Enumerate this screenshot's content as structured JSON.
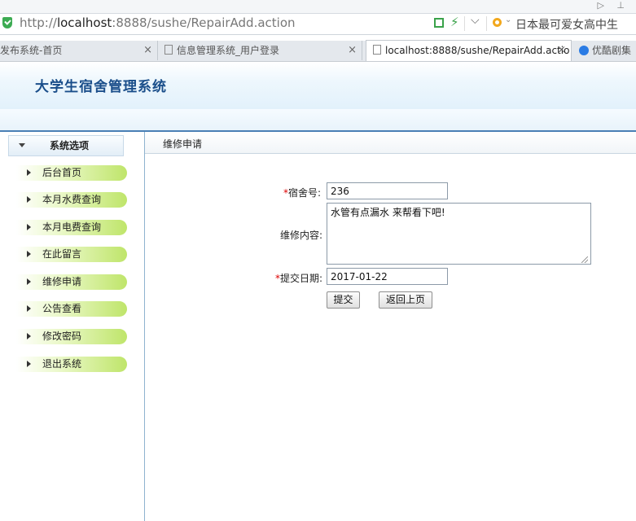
{
  "browser": {
    "window_controls": "▷ ⊥",
    "url_prefix": "http://",
    "url_host": "localhost",
    "url_rest": ":8888/sushe/RepairAdd.action",
    "search_text": "日本最可爱女高中生",
    "tabs": [
      {
        "label": "发布系统-首页",
        "active": false
      },
      {
        "label": "信息管理系统_用户登录",
        "active": false
      },
      {
        "label": "localhost:8888/sushe/RepairAdd.actio",
        "active": true
      },
      {
        "label": "优酷剧集",
        "active": false
      }
    ]
  },
  "app": {
    "title": "大学生宿舍管理系统"
  },
  "sidebar": {
    "header": "系统选项",
    "items": [
      {
        "label": "后台首页"
      },
      {
        "label": "本月水费查询"
      },
      {
        "label": "本月电费查询"
      },
      {
        "label": "在此留言"
      },
      {
        "label": "维修申请"
      },
      {
        "label": "公告查看"
      },
      {
        "label": "修改密码"
      },
      {
        "label": "退出系统"
      }
    ]
  },
  "main": {
    "panel_title": "维修申请",
    "form": {
      "dorm_label": "宿舍号:",
      "dorm_value": "236",
      "content_label": "维修内容:",
      "content_value": "水管有点漏水 来帮看下吧!",
      "date_label": "提交日期:",
      "date_value": "2017-01-22",
      "required_mark": "*",
      "submit_label": "提交",
      "back_label": "返回上页"
    }
  },
  "colors": {
    "title_blue": "#1a4e8a",
    "menu_green": "#bfe56a",
    "required_red": "#dd0000",
    "border_blue": "#4a7fb5"
  }
}
